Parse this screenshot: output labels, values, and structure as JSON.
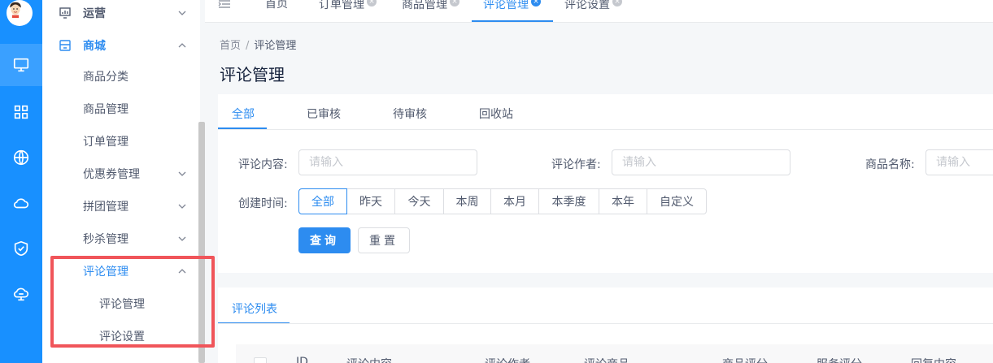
{
  "sidebar": {
    "rail_icons": [
      "monitor-icon",
      "grid-icon",
      "globe-icon",
      "cloud-icon",
      "shield-icon",
      "cloud-network-icon"
    ],
    "items": [
      {
        "label": "运营",
        "icon": "chart-icon"
      },
      {
        "label": "商城",
        "icon": "store-icon"
      },
      {
        "label": "商品分类"
      },
      {
        "label": "商品管理"
      },
      {
        "label": "订单管理"
      },
      {
        "label": "优惠券管理"
      },
      {
        "label": "拼团管理"
      },
      {
        "label": "秒杀管理"
      },
      {
        "label": "评论管理"
      },
      {
        "label": "评论管理"
      },
      {
        "label": "评论设置"
      }
    ]
  },
  "tabs": [
    {
      "label": "首页"
    },
    {
      "label": "订单管理"
    },
    {
      "label": "商品管理"
    },
    {
      "label": "评论管理"
    },
    {
      "label": "评论设置"
    }
  ],
  "breadcrumb": {
    "home": "首页",
    "sep": "/",
    "current": "评论管理"
  },
  "page_title": "评论管理",
  "filter_tabs": [
    "全部",
    "已审核",
    "待审核",
    "回收站"
  ],
  "filters": {
    "content_label": "评论内容:",
    "content_placeholder": "请输入",
    "author_label": "评论作者:",
    "author_placeholder": "请输入",
    "product_label": "商品名称:",
    "product_placeholder": "请输入",
    "time_label": "创建时间:",
    "time_options": [
      "全部",
      "昨天",
      "今天",
      "本周",
      "本月",
      "本季度",
      "本年",
      "自定义"
    ],
    "time_selected": "全部"
  },
  "buttons": {
    "query": "查询",
    "reset": "重置"
  },
  "list": {
    "tab_label": "评论列表",
    "columns": [
      "ID",
      "评论内容",
      "评论作者",
      "评论商品",
      "商品评分",
      "服务评分",
      "回复内容"
    ]
  },
  "colors": {
    "primary": "#2d8cf0",
    "rail": "#1890ff",
    "highlight": "#f0555a"
  }
}
